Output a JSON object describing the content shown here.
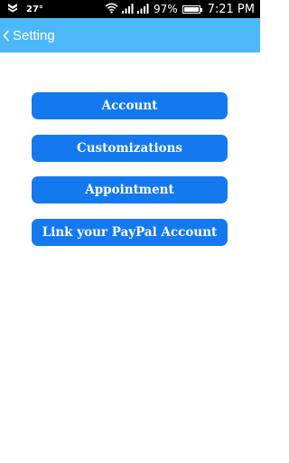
{
  "status_bar": {
    "temperature": "27°",
    "battery_percent": "97%",
    "battery_level": 0.97,
    "time": "7:21 PM",
    "icons": [
      "notification-icon",
      "wifi-icon",
      "signal-icon",
      "signal-icon-2",
      "battery-icon"
    ]
  },
  "app_bar": {
    "back_icon": "chevron-left-icon",
    "title": "Setting",
    "background": "#4db8f8"
  },
  "menu": {
    "button_color": "#1479ef",
    "items": [
      {
        "label": "Account"
      },
      {
        "label": "Customizations"
      },
      {
        "label": "Appointment"
      },
      {
        "label": "Link your PayPal Account"
      }
    ]
  }
}
